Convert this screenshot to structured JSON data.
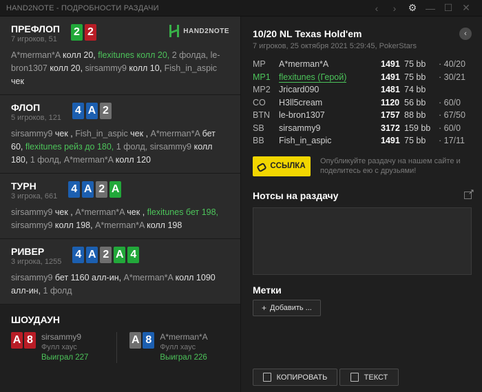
{
  "window": {
    "title": "HAND2NOTE - ПОДРОБНОСТИ РАЗДАЧИ"
  },
  "logo": {
    "text": "HAND2NOTE"
  },
  "streets": [
    {
      "name": "ПРЕФЛОП",
      "sub": "7 игроков, 51",
      "cards": [
        {
          "r": "2",
          "color": "green"
        },
        {
          "r": "2",
          "color": "red"
        }
      ],
      "actions": [
        {
          "t": "A*merman*A ",
          "c": "dim"
        },
        {
          "t": "колл 20, ",
          "c": ""
        },
        {
          "t": "flexitunes колл 20, ",
          "c": "hero"
        },
        {
          "t": "2 фолда, ",
          "c": "dim"
        },
        {
          "t": "le-bron1307 ",
          "c": "dim"
        },
        {
          "t": "колл 20, ",
          "c": ""
        },
        {
          "t": "sirsammy9 ",
          "c": "dim"
        },
        {
          "t": "колл 10, ",
          "c": ""
        },
        {
          "t": "Fish_in_aspic ",
          "c": "dim"
        },
        {
          "t": "чек",
          "c": ""
        }
      ]
    },
    {
      "name": "ФЛОП",
      "sub": "5 игроков, 121",
      "cards": [
        {
          "r": "4",
          "color": "blue"
        },
        {
          "r": "A",
          "color": "blue"
        },
        {
          "r": "2",
          "color": "gray"
        }
      ],
      "actions": [
        {
          "t": "sirsammy9 ",
          "c": "dim"
        },
        {
          "t": "чек , ",
          "c": ""
        },
        {
          "t": "Fish_in_aspic ",
          "c": "dim"
        },
        {
          "t": "чек , ",
          "c": ""
        },
        {
          "t": "A*merman*A ",
          "c": "dim"
        },
        {
          "t": "бет 60, ",
          "c": ""
        },
        {
          "t": "flexitunes рейз до 180, ",
          "c": "hero"
        },
        {
          "t": "1 фолд, ",
          "c": "dim"
        },
        {
          "t": "sirsammy9 ",
          "c": "dim"
        },
        {
          "t": "колл 180, ",
          "c": ""
        },
        {
          "t": "1 фолд, ",
          "c": "dim"
        },
        {
          "t": "A*merman*A ",
          "c": "dim"
        },
        {
          "t": "колл 120",
          "c": ""
        }
      ]
    },
    {
      "name": "ТУРН",
      "sub": "3 игрока, 661",
      "cards": [
        {
          "r": "4",
          "color": "blue"
        },
        {
          "r": "A",
          "color": "blue"
        },
        {
          "r": "2",
          "color": "gray"
        },
        {
          "r": "A",
          "color": "green"
        }
      ],
      "actions": [
        {
          "t": "sirsammy9 ",
          "c": "dim"
        },
        {
          "t": "чек , ",
          "c": ""
        },
        {
          "t": "A*merman*A ",
          "c": "dim"
        },
        {
          "t": "чек , ",
          "c": ""
        },
        {
          "t": "flexitunes бет 198, ",
          "c": "hero"
        },
        {
          "t": "sirsammy9 ",
          "c": "dim"
        },
        {
          "t": "колл 198, ",
          "c": ""
        },
        {
          "t": "A*merman*A ",
          "c": "dim"
        },
        {
          "t": "колл 198",
          "c": ""
        }
      ]
    },
    {
      "name": "РИВЕР",
      "sub": "3 игрока, 1255",
      "cards": [
        {
          "r": "4",
          "color": "blue"
        },
        {
          "r": "A",
          "color": "blue"
        },
        {
          "r": "2",
          "color": "gray"
        },
        {
          "r": "A",
          "color": "green"
        },
        {
          "r": "4",
          "color": "green"
        }
      ],
      "actions": [
        {
          "t": "sirsammy9 ",
          "c": "dim"
        },
        {
          "t": "бет 1160 алл-ин, ",
          "c": ""
        },
        {
          "t": "A*merman*A ",
          "c": "dim"
        },
        {
          "t": "колл 1090 алл-ин, ",
          "c": ""
        },
        {
          "t": "1 фолд",
          "c": "dim"
        }
      ]
    }
  ],
  "showdown": {
    "title": "ШОУДАУН",
    "players": [
      {
        "name": "sirsammy9",
        "hand": "Фулл хаус",
        "result": "Выиграл 227",
        "cards": [
          {
            "r": "A",
            "color": "red"
          },
          {
            "r": "8",
            "color": "red"
          }
        ]
      },
      {
        "name": "A*merman*A",
        "hand": "Фулл хаус",
        "result": "Выиграл 226",
        "cards": [
          {
            "r": "A",
            "color": "gray"
          },
          {
            "r": "8",
            "color": "blue"
          }
        ]
      }
    ]
  },
  "game": {
    "title": "10/20 NL Texas Hold'em",
    "sub": "7 игроков, 25 октября 2021 5:29:45, PokerStars"
  },
  "players": [
    {
      "pos": "MP",
      "name": "A*merman*A",
      "stack": "1491",
      "bb": "75 bb",
      "stat": "· 40/20",
      "hero": false
    },
    {
      "pos": "MP1",
      "name": "flexitunes (Герой)",
      "stack": "1491",
      "bb": "75 bb",
      "stat": "· 30/21",
      "hero": true
    },
    {
      "pos": "MP2",
      "name": "Jricard090",
      "stack": "1481",
      "bb": "74 bb",
      "stat": "",
      "hero": false
    },
    {
      "pos": "CO",
      "name": "H3ll5cream",
      "stack": "1120",
      "bb": "56 bb",
      "stat": "· 60/0",
      "hero": false
    },
    {
      "pos": "BTN",
      "name": "le-bron1307",
      "stack": "1757",
      "bb": "88 bb",
      "stat": "· 67/50",
      "hero": false
    },
    {
      "pos": "SB",
      "name": "sirsammy9",
      "stack": "3172",
      "bb": "159 bb",
      "stat": "· 60/0",
      "hero": false
    },
    {
      "pos": "BB",
      "name": "Fish_in_aspic",
      "stack": "1491",
      "bb": "75 bb",
      "stat": "· 17/11",
      "hero": false
    }
  ],
  "share": {
    "button": "ССЫЛКА",
    "text": "Опубликуйте раздачу на нашем сайте и поделитесь ею с друзьями!"
  },
  "notes": {
    "title": "Нотсы на раздачу"
  },
  "tags": {
    "title": "Метки",
    "add": "Добавить ..."
  },
  "buttons": {
    "copy": "КОПИРОВАТЬ",
    "text": "ТЕКСТ"
  },
  "colors": {
    "green": "#22a83a",
    "red": "#b81d26",
    "blue": "#1c5fb0",
    "gray": "#6f6f6f",
    "accent": "#f2d600"
  }
}
